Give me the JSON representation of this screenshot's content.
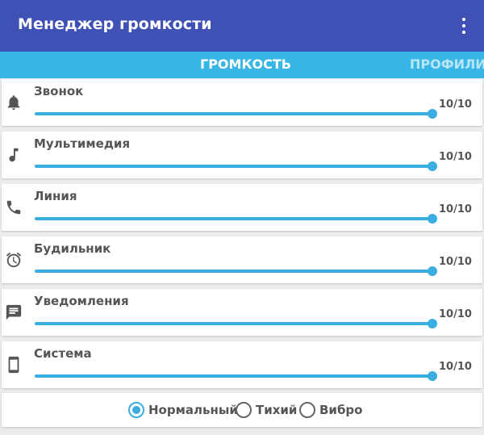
{
  "app": {
    "title": "Менеджер громкости",
    "menu_icon": "more-vert-icon",
    "bar_color": "#3f51b5"
  },
  "tabs": [
    {
      "label": "ГРОМКОСТЬ",
      "active": true
    },
    {
      "label": "ПРОФИЛИ",
      "active": false
    }
  ],
  "tab_bar_color": "#38b6e6",
  "accent": "#3aaee0",
  "streams": [
    {
      "icon": "bell-icon",
      "label": "Звонок",
      "value_text": "10/10",
      "level": 10,
      "max": 10
    },
    {
      "icon": "music-note-icon",
      "label": "Мультимедия",
      "value_text": "10/10",
      "level": 10,
      "max": 10
    },
    {
      "icon": "phone-icon",
      "label": "Линия",
      "value_text": "10/10",
      "level": 10,
      "max": 10
    },
    {
      "icon": "alarm-clock-icon",
      "label": "Будильник",
      "value_text": "10/10",
      "level": 10,
      "max": 10
    },
    {
      "icon": "message-icon",
      "label": "Уведомления",
      "value_text": "10/10",
      "level": 10,
      "max": 10
    },
    {
      "icon": "smartphone-icon",
      "label": "Система",
      "value_text": "10/10",
      "level": 10,
      "max": 10
    }
  ],
  "modes": [
    {
      "label": "Нормальный",
      "selected": true
    },
    {
      "label": "Тихий",
      "selected": false
    },
    {
      "label": "Вибро",
      "selected": false
    }
  ]
}
